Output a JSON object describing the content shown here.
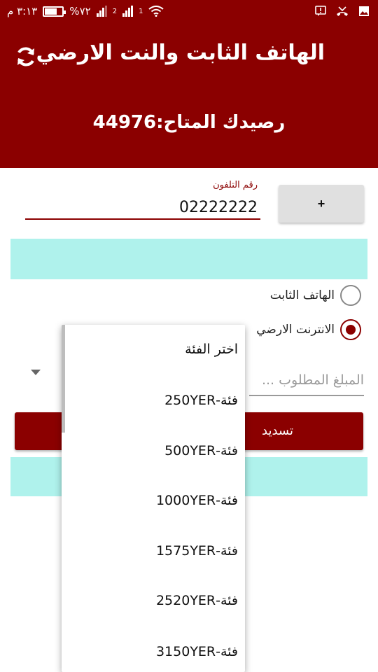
{
  "status_bar": {
    "time": "٣:١٣ م",
    "battery": "%٧٢",
    "battery_level": 0.72,
    "sim1_label": "1",
    "sim2_label": "2",
    "icons": [
      "battery-icon",
      "signal-icon",
      "wifi-icon",
      "message-icon",
      "missed-call-icon",
      "image-icon"
    ]
  },
  "header": {
    "title": "الهاتف الثابت والنت الارضي",
    "balance": "رصيدك المتاح:44976"
  },
  "form": {
    "phone_label": "رقم التلفون",
    "phone_value": "02222222",
    "plus_label": "+",
    "radio_landline": "الهاتف الثابت",
    "radio_internet": "الانترنت الارضي",
    "amount_placeholder": "المبلغ المطلوب ...",
    "pay_label": "تسديد",
    "accent": "#8b0000",
    "cyan": "#aff2ec"
  },
  "dropdown": {
    "items": [
      "اختر الفئة",
      "فئة-250YER",
      "فئة-500YER",
      "فئة-1000YER",
      "فئة-1575YER",
      "فئة-2520YER",
      "فئة-3150YER"
    ]
  }
}
